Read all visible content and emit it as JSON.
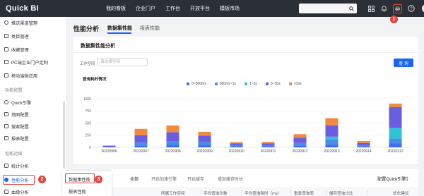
{
  "app": {
    "logo": "Quick BI"
  },
  "nav": {
    "items": [
      "我的看板",
      "企业门户",
      "工作台",
      "开放平台",
      "模板市场"
    ]
  },
  "search": {
    "placeholder": ""
  },
  "top_icons": [
    "grid-icon",
    "bell-icon",
    "gear-icon",
    "help-icon",
    "avatar"
  ],
  "annotations": {
    "one": "1",
    "two": "2",
    "three": "3"
  },
  "sidebar": {
    "items": [
      {
        "label": "推送渠道管理",
        "icon": "push-channel-icon"
      },
      {
        "label": "类目管理",
        "icon": "category-icon"
      },
      {
        "label": "收藏管理",
        "icon": "favorite-icon"
      },
      {
        "label": "PC端企业门户定制",
        "icon": "portal-icon"
      },
      {
        "label": "移动端微应用",
        "icon": "mobile-icon"
      }
    ],
    "section_feature": "功能配置",
    "feature_items": [
      {
        "label": "Quick引擎",
        "icon": "engine-icon"
      },
      {
        "label": "地图配置",
        "icon": "map-icon"
      },
      {
        "label": "搜索配置",
        "icon": "search-config-icon"
      },
      {
        "label": "报表配置",
        "icon": "report-config-icon"
      }
    ],
    "section_ops": "智能运维",
    "ops_items": [
      {
        "label": "统计分析",
        "icon": "stats-icon"
      },
      {
        "label": "性能分析",
        "icon": "performance-icon"
      },
      {
        "label": "血缘分析",
        "icon": "lineage-icon"
      }
    ]
  },
  "submenu": {
    "items": [
      "数据集性能",
      "报表性能"
    ]
  },
  "header": {
    "title": "性能分析",
    "tabs": [
      "数据集性能",
      "报表性能"
    ]
  },
  "card": {
    "title": "数据集性能分析",
    "workspace_label": "工作空间",
    "workspace_placeholder": "请选择空间",
    "query_button": "查 询",
    "chart_title": "查询耗时情况"
  },
  "bottom": {
    "tabs": [
      "全部",
      "开启加速引擎",
      "开启缓存",
      "增加缓存时长"
    ],
    "config_link": "配置Quick引擎》",
    "columns": [
      "所属工作空间",
      "平均查询次数",
      "平均查询耗时（ms）",
      "重复查询率",
      "缓存查询占比",
      "优化建议"
    ]
  },
  "colors": {
    "accent": "#1b64f0",
    "annotation": "#e0463f",
    "series": [
      "#3b6ff0",
      "#4a8de8",
      "#2ec4d6",
      "#6a5de0",
      "#f08a3c"
    ]
  },
  "chart_data": {
    "type": "bar",
    "stacked": true,
    "title": "查询耗时情况",
    "categories": [
      "20220906",
      "20220907",
      "20220908",
      "20220909",
      "20220910",
      "20220911",
      "20220912",
      "20220913",
      "20220914",
      "20220212"
    ],
    "series": [
      {
        "name": "0~500ms",
        "values": [
          10,
          40,
          50,
          50,
          20,
          20,
          40,
          60,
          20,
          80
        ]
      },
      {
        "name": "500ms~1s",
        "values": [
          0,
          60,
          80,
          60,
          30,
          25,
          50,
          100,
          25,
          100
        ]
      },
      {
        "name": "1~3s",
        "values": [
          0,
          0,
          0,
          0,
          0,
          0,
          0,
          60,
          0,
          220
        ]
      },
      {
        "name": "3~10s",
        "values": [
          20,
          150,
          180,
          130,
          30,
          35,
          110,
          230,
          45,
          430
        ]
      },
      {
        "name": ">10s",
        "values": [
          10,
          130,
          140,
          80,
          25,
          30,
          70,
          150,
          40,
          70
        ]
      }
    ],
    "ylim": [
      0,
      1000
    ],
    "yticks": [
      0,
      250,
      500,
      750,
      1000
    ],
    "legend_position": "top"
  }
}
